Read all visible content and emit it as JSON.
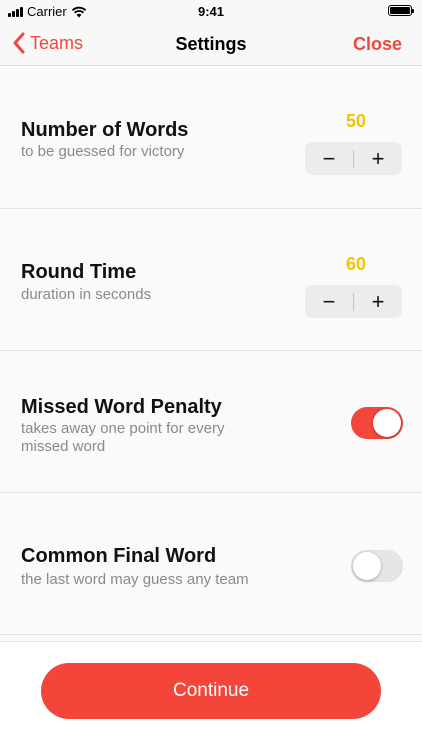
{
  "status_bar": {
    "carrier": "Carrier",
    "time": "9:41"
  },
  "nav": {
    "back_label": "Teams",
    "title": "Settings",
    "close_label": "Close"
  },
  "settings": [
    {
      "title": "Number of Words",
      "subtitle": "to be guessed for victory",
      "value": "50",
      "control": "stepper",
      "minus": "−",
      "plus": "+"
    },
    {
      "title": "Round Time",
      "subtitle": "duration in seconds",
      "value": "60",
      "control": "stepper",
      "minus": "−",
      "plus": "+"
    },
    {
      "title": "Missed Word Penalty",
      "subtitle": "takes away one point for every missed word",
      "control": "toggle",
      "enabled": true
    },
    {
      "title": "Common Final Word",
      "subtitle": "the last word may guess any team",
      "control": "toggle",
      "enabled": false
    }
  ],
  "footer": {
    "continue_label": "Continue"
  },
  "colors": {
    "accent": "#f2473a",
    "value": "#f5c400",
    "subtitle": "#8a8a8a"
  }
}
